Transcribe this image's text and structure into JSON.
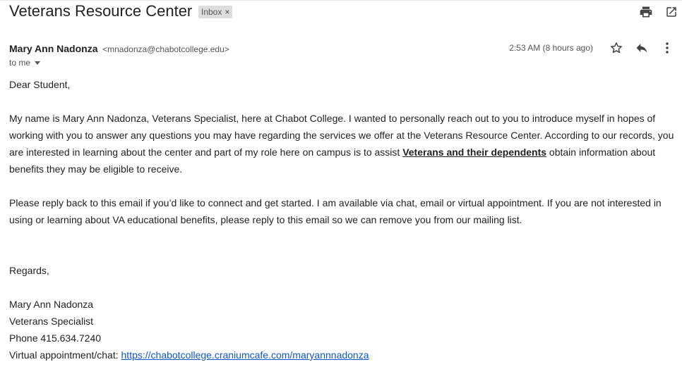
{
  "subject": "Veterans Resource Center",
  "label_chip": {
    "text": "Inbox",
    "remove": "×"
  },
  "icons": {
    "print": "print-icon",
    "open_new_window": "open-in-new-window-icon",
    "star": "star-icon",
    "reply": "reply-icon",
    "more": "more-vertical-icon",
    "dropdown": "caret-down-icon"
  },
  "sender": {
    "name": "Mary Ann Nadonza",
    "email": "<mnadonza@chabotcollege.edu>",
    "to": "to me",
    "timestamp": "2:53 AM (8 hours ago)"
  },
  "body": {
    "greeting": "Dear Student,",
    "p1_before": "My name is Mary Ann Nadonza, Veterans Specialist, here at Chabot College. I wanted to personally reach out to you to introduce myself in hopes of working with you to answer any questions you may have regarding the services we offer at the Veterans Resource Center. According to our records, you are interested in learning about the center and part of my role here on campus is to assist ",
    "p1_bold": "Veterans and their dependents",
    "p1_after": " obtain information about benefits they may be eligible to receive.",
    "p2": "Please reply back to this email if you’d like to connect and get started. I am available via chat, email or virtual appointment. If you are not interested in using or learning about VA educational benefits, please reply to this email so we can remove you from our mailing list.",
    "regards": "Regards,",
    "sig_name": "Mary Ann Nadonza",
    "sig_title": "Veterans Specialist",
    "sig_phone": "Phone 415.634.7240",
    "sig_chat_label": "Virtual appointment/chat: ",
    "sig_chat_link": "https://chabotcollege.craniumcafe.com/maryannnadonza"
  }
}
